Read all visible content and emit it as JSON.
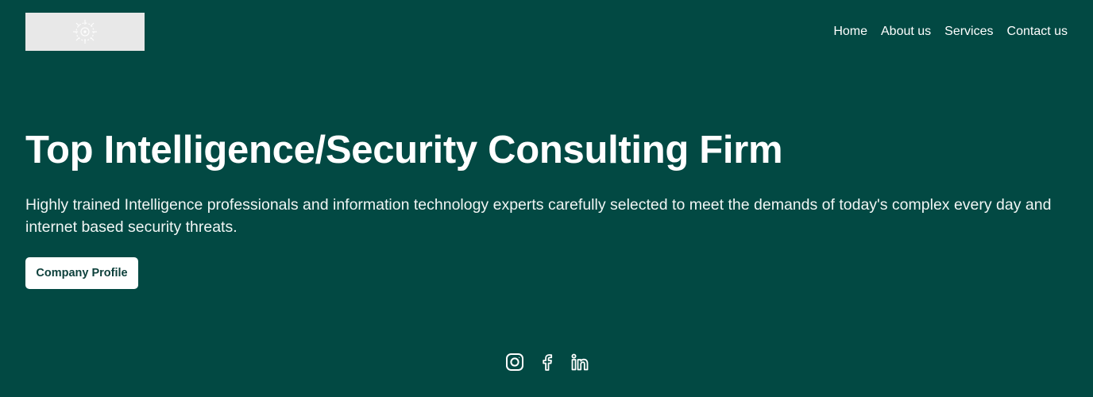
{
  "header": {
    "logo_icon": "compass-emblem-icon",
    "nav": [
      {
        "label": "Home"
      },
      {
        "label": "About us"
      },
      {
        "label": "Services"
      },
      {
        "label": "Contact us"
      }
    ]
  },
  "hero": {
    "title": "Top Intelligence/Security Consulting Firm",
    "subtitle": "Highly trained Intelligence professionals and information technology experts carefully selected to meet the demands of today's complex every day and internet based security threats.",
    "cta_label": "Company Profile"
  },
  "social": {
    "icons": [
      "instagram-icon",
      "facebook-icon",
      "linkedin-icon"
    ]
  },
  "colors": {
    "background": "#024943",
    "text": "#ffffff",
    "button_bg": "#ffffff",
    "button_text": "#0c3f3a",
    "logo_bg": "#e8e8e8"
  }
}
